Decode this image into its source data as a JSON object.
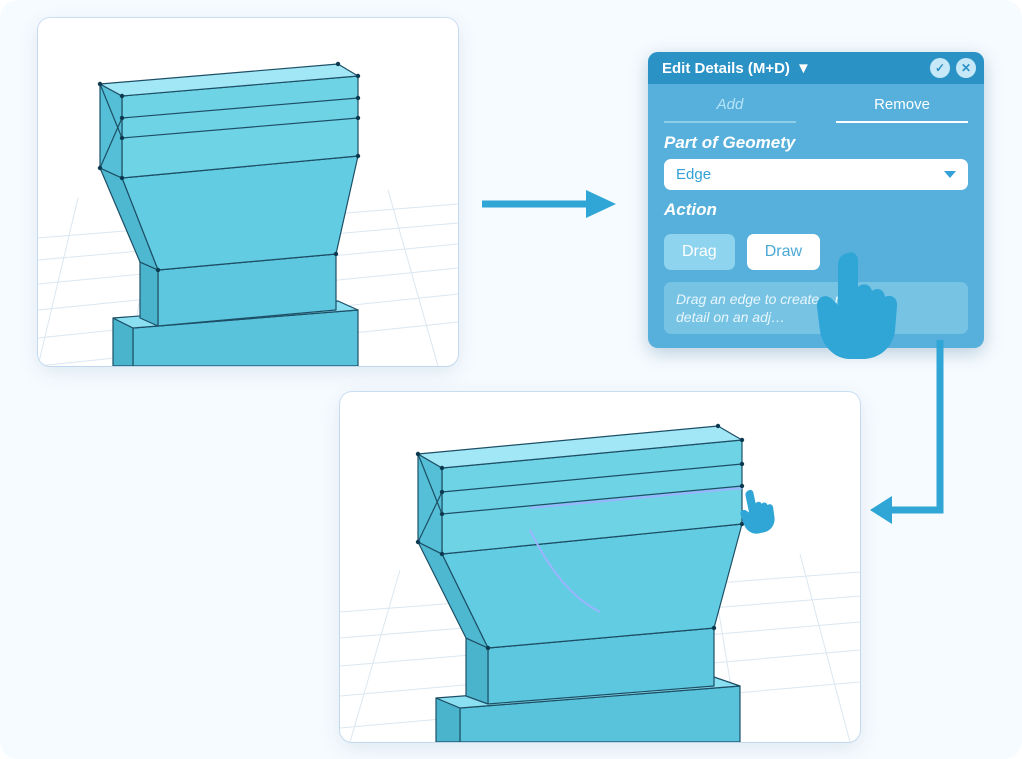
{
  "dialog": {
    "title": "Edit Details (M+D)",
    "check_icon": "✓",
    "close_icon": "✕",
    "tabs": {
      "add": "Add",
      "remove": "Remove",
      "active": "remove"
    },
    "part_label": "Part of Geomety",
    "part_value": "Edge",
    "action_label": "Action",
    "buttons": {
      "drag": "Drag",
      "draw": "Draw"
    },
    "hint_line1": "Drag an edge to create a new",
    "hint_line2": "detail on an adj…"
  },
  "panels": {
    "top": "3D viewport — before",
    "bottom": "3D viewport — after edge drag"
  },
  "colors": {
    "accent": "#2b92c6",
    "panel": "#57b0db",
    "shape_fill": "#6fd2e5",
    "shape_edge": "#1d4f66"
  }
}
